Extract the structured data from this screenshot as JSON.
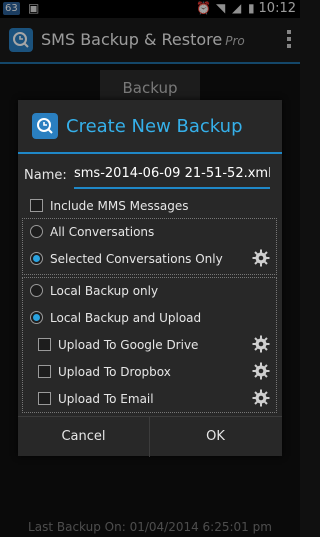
{
  "status_bar": {
    "badge": "63",
    "time": "10:12"
  },
  "action_bar": {
    "title": "SMS Backup & Restore",
    "pro": "Pro"
  },
  "background": {
    "backup_button": "Backup",
    "last_backup": "Last Backup On: 01/04/2014 6:25:01 pm"
  },
  "dialog": {
    "title": "Create New Backup",
    "name_label": "Name:",
    "name_value": "sms-2014-06-09 21-51-52.xml",
    "include_mms": {
      "label": "Include MMS Messages",
      "checked": false
    },
    "conversations": [
      {
        "label": "All Conversations",
        "selected": false
      },
      {
        "label": "Selected Conversations Only",
        "selected": true
      }
    ],
    "backup_location": [
      {
        "label": "Local Backup only",
        "selected": false
      },
      {
        "label": "Local Backup and Upload",
        "selected": true
      }
    ],
    "upload_targets": [
      {
        "label": "Upload To Google Drive",
        "checked": false
      },
      {
        "label": "Upload To Dropbox",
        "checked": false
      },
      {
        "label": "Upload To Email",
        "checked": false
      }
    ],
    "cancel": "Cancel",
    "ok": "OK"
  }
}
